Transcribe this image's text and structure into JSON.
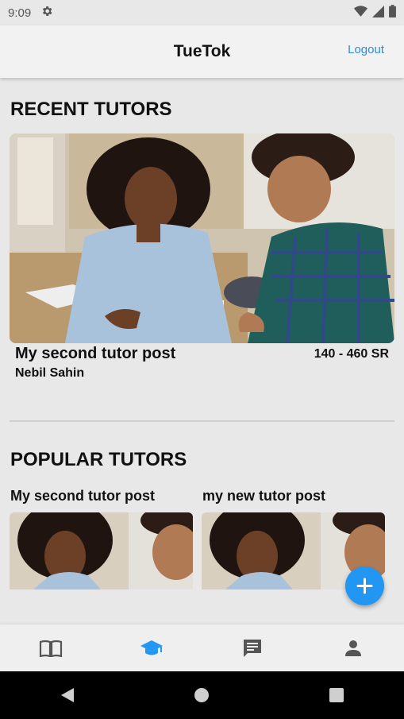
{
  "status": {
    "time": "9:09"
  },
  "header": {
    "title": "TueTok",
    "logout_label": "Logout"
  },
  "recent": {
    "section_title": "RECENT TUTORS",
    "post_title": "My second tutor post",
    "author": "Nebil Sahin",
    "price": "140 - 460 SR"
  },
  "popular": {
    "section_title": "POPULAR TUTORS",
    "cards": [
      {
        "title": "My second tutor post"
      },
      {
        "title": "my new tutor post"
      }
    ]
  },
  "fab": {
    "icon": "plus-icon"
  },
  "bottom_nav": {
    "items": [
      {
        "icon": "book-icon"
      },
      {
        "icon": "graduation-cap-icon",
        "active": true
      },
      {
        "icon": "chat-icon"
      },
      {
        "icon": "person-icon"
      }
    ]
  },
  "colors": {
    "accent": "#2196f3",
    "link": "#2a8fd8"
  }
}
